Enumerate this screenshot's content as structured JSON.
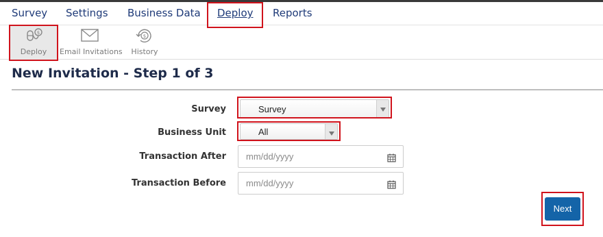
{
  "main_nav": {
    "items": [
      {
        "label": "Survey"
      },
      {
        "label": "Settings"
      },
      {
        "label": "Business Data"
      },
      {
        "label": "Deploy"
      },
      {
        "label": "Reports"
      }
    ],
    "active": "Deploy"
  },
  "sub_nav": {
    "items": [
      {
        "label": "Deploy",
        "icon": "deploy-icon"
      },
      {
        "label": "Email Invitations",
        "icon": "envelope-icon"
      },
      {
        "label": "History",
        "icon": "history-icon"
      }
    ],
    "active": "Deploy"
  },
  "page": {
    "title": "New Invitation - Step 1 of 3"
  },
  "form": {
    "survey": {
      "label": "Survey",
      "value": "Survey"
    },
    "business_unit": {
      "label": "Business Unit",
      "value": "All"
    },
    "transaction_after": {
      "label": "Transaction After",
      "placeholder": "mm/dd/yyyy"
    },
    "transaction_before": {
      "label": "Transaction Before",
      "placeholder": "mm/dd/yyyy"
    }
  },
  "actions": {
    "next_label": "Next"
  },
  "colors": {
    "nav_text": "#1e3a78",
    "highlight_box": "#d0121b",
    "primary_button": "#1464a8"
  }
}
